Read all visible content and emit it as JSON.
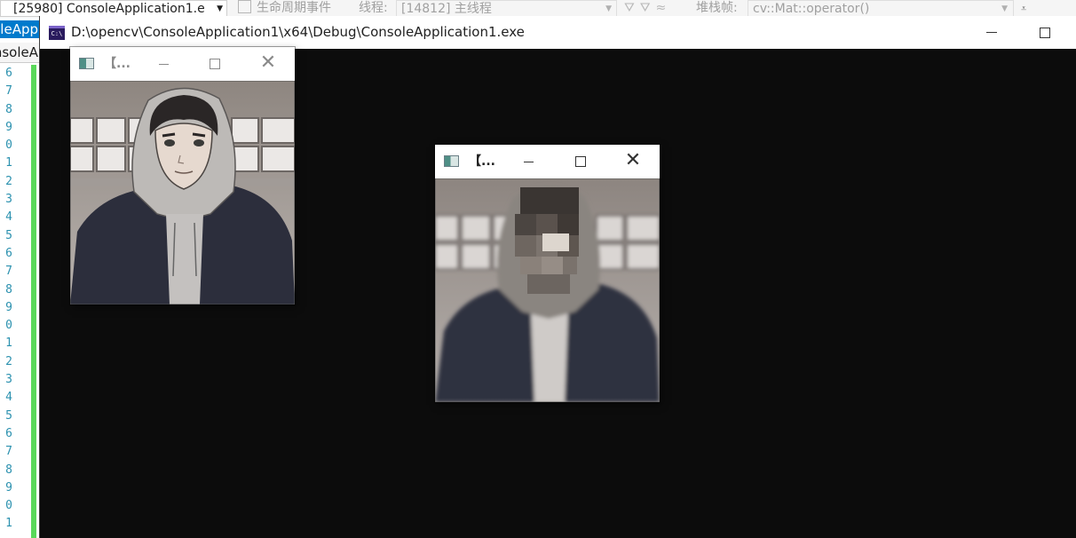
{
  "vs_toolbar": {
    "process_dropdown": "[25980] ConsoleApplication1.e",
    "lifecycle_label": "生命周期事件",
    "thread_label": "线程:",
    "thread_value": "[14812] 主线程",
    "stack_label": "堆栈帧:",
    "stack_value": "cv::Mat::operator()"
  },
  "vs_editor": {
    "active_tab": "leApp",
    "second_tab": "nsoleA",
    "line_numbers": [
      "6",
      "7",
      "8",
      "9",
      "0",
      "1",
      "2",
      "3",
      "4",
      "5",
      "6",
      "7",
      "8",
      "9",
      "0",
      "1",
      "2",
      "3",
      "4",
      "5",
      "6",
      "7",
      "8",
      "9",
      "0",
      "1"
    ]
  },
  "console_window": {
    "icon_text": "C:\\",
    "title": "D:\\opencv\\ConsoleApplication1\\x64\\Debug\\ConsoleApplication1.exe"
  },
  "image_windows": [
    {
      "title": "【...",
      "image": "original anime portrait",
      "focused": false
    },
    {
      "title": "【...",
      "image": "mosaic pixelated portrait",
      "focused": true
    }
  ],
  "icons": {
    "chevron": "chevron-down-icon",
    "minimize": "minimize-icon",
    "maximize": "maximize-icon",
    "close": "close-icon"
  }
}
